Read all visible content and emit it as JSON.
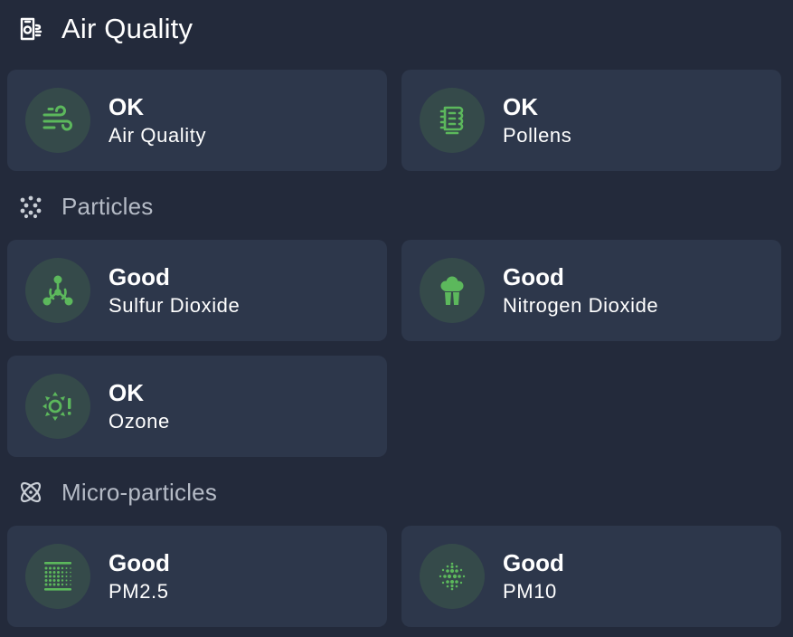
{
  "header": {
    "title": "Air Quality",
    "icon": "air-filter-icon"
  },
  "colors": {
    "background": "#232a3b",
    "card": "#2d374b",
    "icon_circle": "#354a4a",
    "icon_green": "#5cb85c",
    "section_text": "#b5bbc6"
  },
  "overview": {
    "cards": [
      {
        "state": "OK",
        "label": "Air Quality",
        "icon": "wind-icon"
      },
      {
        "state": "OK",
        "label": "Pollens",
        "icon": "pollen-icon"
      }
    ]
  },
  "particles": {
    "title": "Particles",
    "icon": "dots-icon",
    "cards": [
      {
        "state": "Good",
        "label": "Sulfur Dioxide",
        "icon": "molecule-icon"
      },
      {
        "state": "Good",
        "label": "Nitrogen Dioxide",
        "icon": "factory-smoke-icon"
      },
      {
        "state": "OK",
        "label": "Ozone",
        "icon": "sun-alert-icon"
      }
    ]
  },
  "micro_particles": {
    "title": "Micro-particles",
    "icon": "atom-icon",
    "cards": [
      {
        "state": "Good",
        "label": "PM2.5",
        "icon": "grid-dots-icon"
      },
      {
        "state": "Good",
        "label": "PM10",
        "icon": "sphere-dots-icon"
      }
    ]
  }
}
